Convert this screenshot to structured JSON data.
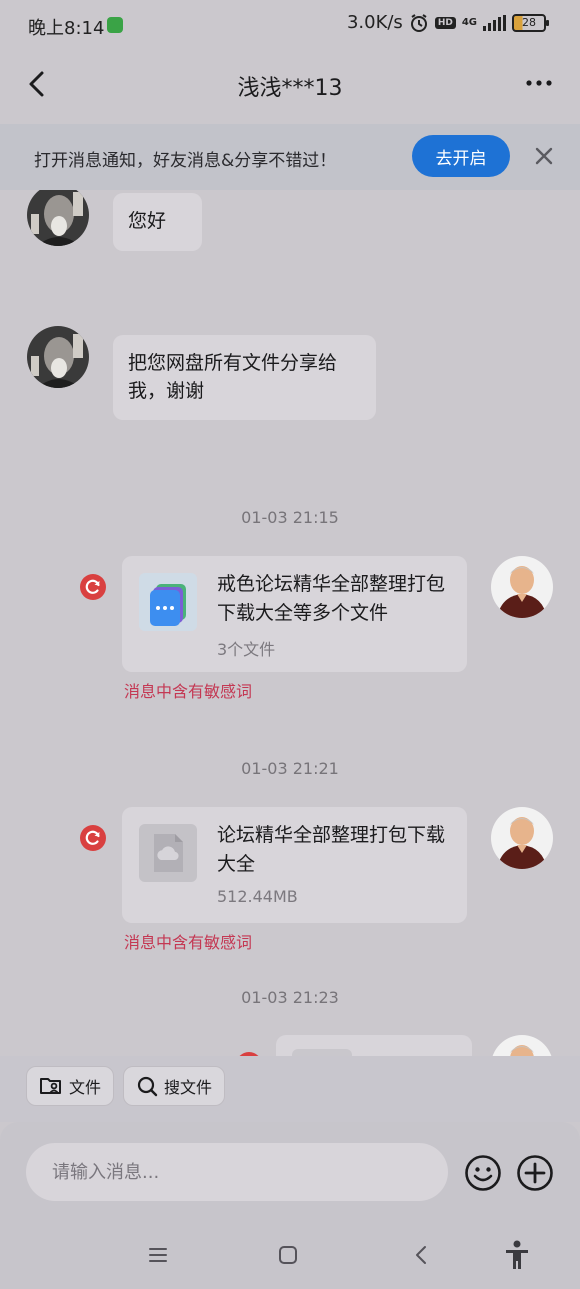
{
  "status_bar": {
    "time": "晚上8:14",
    "net_speed": "3.0K/s",
    "hd_label": "HD",
    "network_type": "4G",
    "battery_level": "28"
  },
  "header": {
    "title": "浅浅***13",
    "back_icon": "chevron-left-icon",
    "more_icon": "ellipsis-icon"
  },
  "notice": {
    "text": "打开消息通知，好友消息&分享不错过！",
    "button_label": "去开启",
    "close_icon": "close-icon"
  },
  "messages": [
    {
      "side": "left",
      "type": "text",
      "text": "您好"
    },
    {
      "side": "left",
      "type": "text",
      "text": "把您网盘所有文件分享给我，谢谢"
    },
    {
      "type": "timestamp",
      "text": "01-03 21:15"
    },
    {
      "side": "right",
      "type": "file",
      "title": "戒色论坛精华全部整理打包下载大全等多个文件",
      "subtitle": "3个文件",
      "status": "消息中含有敏感词"
    },
    {
      "type": "timestamp",
      "text": "01-03 21:21"
    },
    {
      "side": "right",
      "type": "file",
      "title": "论坛精华全部整理打包下载大全",
      "subtitle": "512.44MB",
      "status": "消息中含有敏感词"
    },
    {
      "type": "timestamp",
      "text": "01-03 21:23"
    }
  ],
  "chips": [
    {
      "label": "文件",
      "icon": "folder-user-icon"
    },
    {
      "label": "搜文件",
      "icon": "search-icon"
    }
  ],
  "input": {
    "placeholder": "请输入消息...",
    "value": ""
  },
  "colors": {
    "accent": "#1e72d5",
    "warning": "#c43853",
    "retry": "#d94040"
  }
}
